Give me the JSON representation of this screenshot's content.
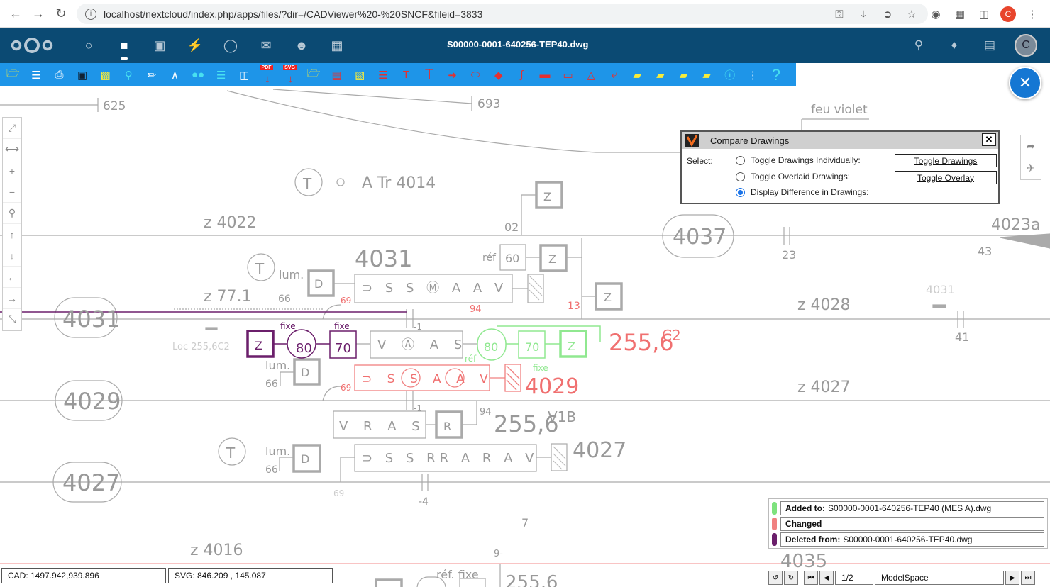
{
  "browser": {
    "url": "localhost/nextcloud/index.php/apps/files/?dir=/CADViewer%20-%20SNCF&fileid=3833",
    "profile_initial": "C"
  },
  "header": {
    "title": "S00000-0001-640256-TEP40.dwg",
    "avatar_initial": "C"
  },
  "toolbar": {
    "pdf_label": "PDF",
    "svg_label": "SVG",
    "help_label": "?"
  },
  "dialog": {
    "title": "Compare Drawings",
    "select_label": "Select:",
    "options": [
      {
        "label": "Toggle Drawings Individually:",
        "selected": false
      },
      {
        "label": "Toggle Overlaid Drawings:",
        "selected": false
      },
      {
        "label": "Display Difference in Drawings:",
        "selected": true
      }
    ],
    "toggle_drawings_label": "Toggle Drawings",
    "toggle_overlay_label": "Toggle Overlay"
  },
  "legend": {
    "added_label": "Added to:",
    "added_file": "S00000-0001-640256-TEP40 (MES A).dwg",
    "changed_label": "Changed",
    "deleted_label": "Deleted from:",
    "deleted_file": "S00000-0001-640256-TEP40.dwg",
    "colors": {
      "added": "#7ee27e",
      "changed": "#f08080",
      "deleted": "#6b1f6b"
    }
  },
  "status": {
    "cad_coords": "CAD: 1497.942,939.896",
    "svg_coords": "SVG: 846.209 , 145.087",
    "page": "1/2",
    "space": "ModelSpace"
  },
  "drawing": {
    "labels": {
      "l625": "625",
      "l693": "693",
      "feu_violet": "feu violet",
      "t_a_tr": "A Tr 4014",
      "z4022": "z 4022",
      "o2": "02",
      "box4037": "4037",
      "l4023a": "4023a",
      "l23": "23",
      "l43": "43",
      "ref1": "réf",
      "l60": "60",
      "l4031_big": "4031",
      "lum1": "lum.",
      "l66a": "66",
      "l69a": "69",
      "z771": "z 77.1",
      "l94a": "94",
      "l13": "13",
      "z4028": "z 4028",
      "l4031_small": "4031",
      "l41": "41",
      "box4031": "4031",
      "fixe1": "fixe",
      "fixe2": "fixe",
      "l80a": "80",
      "l70a": "70",
      "loc": "Loc 255,6C2",
      "l1a": "-1",
      "l80b": "80",
      "l70b": "70",
      "ref2": "réf",
      "big2556c2": "255,6",
      "sup_c2": "C2",
      "lum2": "lum.",
      "l66b": "66",
      "fixe3": "fixe",
      "l69b": "69",
      "red4029": "4029",
      "box4029": "4029",
      "z4027a": "z 4027",
      "l1b": "-1",
      "l94b": "94",
      "big2556v1b": "255,6",
      "sup_v1b": "V1B",
      "lum3": "lum.",
      "l66c": "66",
      "gray4027": "4027",
      "box4027": "4027",
      "l69c": "69",
      "l4b": "-4",
      "l7": "7",
      "z4016": "z 4016",
      "l9": "9-",
      "ref_fixe": "réf. fixe",
      "l4035": "4035",
      "l2556d": "255,6"
    }
  }
}
